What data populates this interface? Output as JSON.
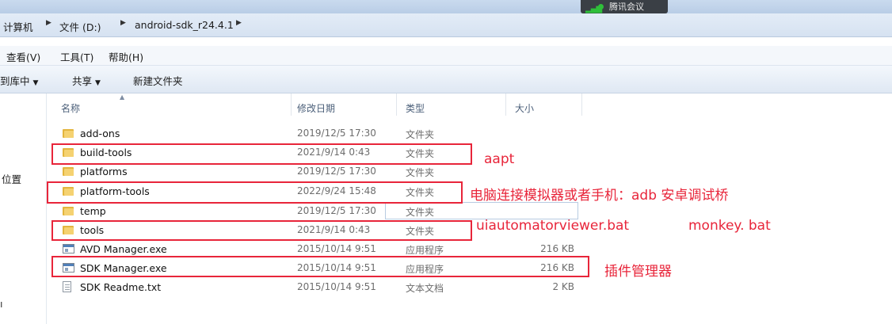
{
  "taskbar": {
    "meeting_label": "腾讯会议"
  },
  "address": {
    "crumbs": [
      "计算机",
      "文件 (D:)",
      "android-sdk_r24.4.1"
    ]
  },
  "menu": {
    "view": "查看(V)",
    "tools": "工具(T)",
    "help": "帮助(H)"
  },
  "toolbar": {
    "include_library": "到库中",
    "share": "共享",
    "new_folder": "新建文件夹"
  },
  "nav": {
    "location": "位置"
  },
  "columns": {
    "name": "名称",
    "date": "修改日期",
    "type": "类型",
    "size": "大小"
  },
  "files": [
    {
      "name": "add-ons",
      "date": "2019/12/5 17:30",
      "type": "文件夹",
      "size": "",
      "icon": "folder-icon"
    },
    {
      "name": "build-tools",
      "date": "2021/9/14 0:43",
      "type": "文件夹",
      "size": "",
      "icon": "folder-icon"
    },
    {
      "name": "platforms",
      "date": "2019/12/5 17:30",
      "type": "文件夹",
      "size": "",
      "icon": "folder-icon"
    },
    {
      "name": "platform-tools",
      "date": "2022/9/24 15:48",
      "type": "文件夹",
      "size": "",
      "icon": "folder-icon"
    },
    {
      "name": "temp",
      "date": "2019/12/5 17:30",
      "type": "文件夹",
      "size": "",
      "icon": "folder-icon"
    },
    {
      "name": "tools",
      "date": "2021/9/14 0:43",
      "type": "文件夹",
      "size": "",
      "icon": "folder-icon"
    },
    {
      "name": "AVD Manager.exe",
      "date": "2015/10/14 9:51",
      "type": "应用程序",
      "size": "216 KB",
      "icon": "exe-icon"
    },
    {
      "name": "SDK Manager.exe",
      "date": "2015/10/14 9:51",
      "type": "应用程序",
      "size": "216 KB",
      "icon": "exe-icon"
    },
    {
      "name": "SDK Readme.txt",
      "date": "2015/10/14 9:51",
      "type": "文本文档",
      "size": "2 KB",
      "icon": "text-file-icon"
    }
  ],
  "annotations": {
    "build_tools": "aapt",
    "platform_tools": "电脑连接模拟器或者手机：adb 安卓调试桥",
    "tools_1": "uiautomatorviewer.bat",
    "tools_2": "monkey. bat",
    "sdk_manager": "插件管理器"
  },
  "colors": {
    "annotation": "#e8253a",
    "folder": "#f5d271"
  }
}
